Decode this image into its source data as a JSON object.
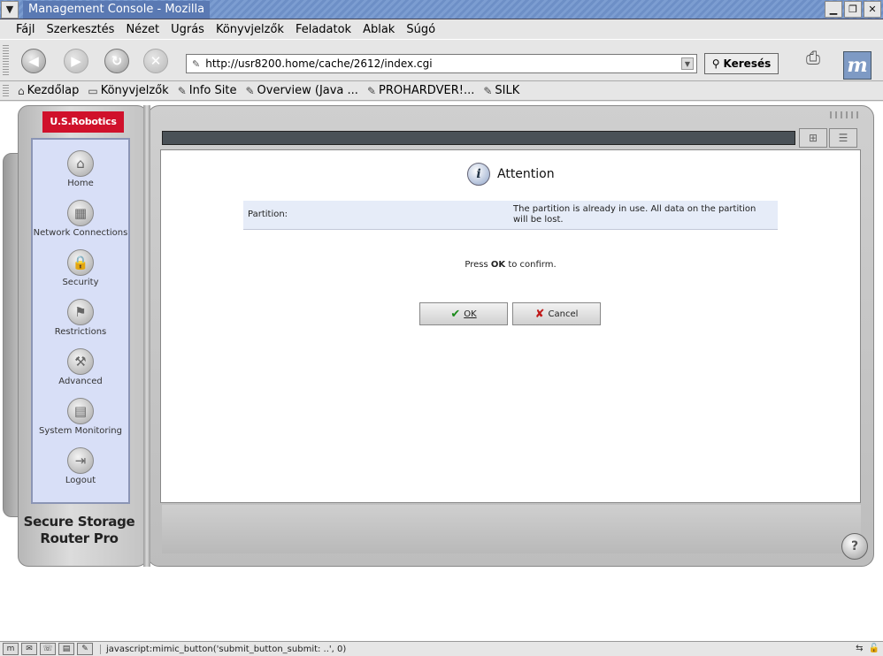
{
  "window": {
    "title": "Management Console - Mozilla"
  },
  "menu": [
    "Fájl",
    "Szerkesztés",
    "Nézet",
    "Ugrás",
    "Könyvjelzők",
    "Feladatok",
    "Ablak",
    "Súgó"
  ],
  "nav": {
    "url": "http://usr8200.home/cache/2612/index.cgi",
    "search_label": "Keresés"
  },
  "bookmarks": [
    "Kezdőlap",
    "Könyvjelzők",
    "Info Site",
    "Overview (Java ...",
    "PROHARDVER!...",
    "SILK"
  ],
  "app": {
    "logo_text": "U.S.Robotics",
    "brand_line1": "Secure Storage",
    "brand_line2": "Router Pro",
    "sidebar": [
      {
        "label": "Home",
        "icon": "home-icon"
      },
      {
        "label": "Network Connections",
        "icon": "network-icon"
      },
      {
        "label": "Security",
        "icon": "lock-icon"
      },
      {
        "label": "Restrictions",
        "icon": "restrictions-icon"
      },
      {
        "label": "Advanced",
        "icon": "tools-icon"
      },
      {
        "label": "System Monitoring",
        "icon": "monitor-icon"
      },
      {
        "label": "Logout",
        "icon": "logout-icon"
      }
    ]
  },
  "dialog": {
    "title": "Attention",
    "row_label": "Partition:",
    "row_value": "The partition is already in use. All data on the partition will be lost.",
    "confirm_pre": "Press",
    "confirm_bold": "OK",
    "confirm_post": "to confirm.",
    "ok_label": "OK",
    "cancel_label": "Cancel"
  },
  "status": {
    "text": "javascript:mimic_button('submit_button_submit: ..', 0)"
  }
}
